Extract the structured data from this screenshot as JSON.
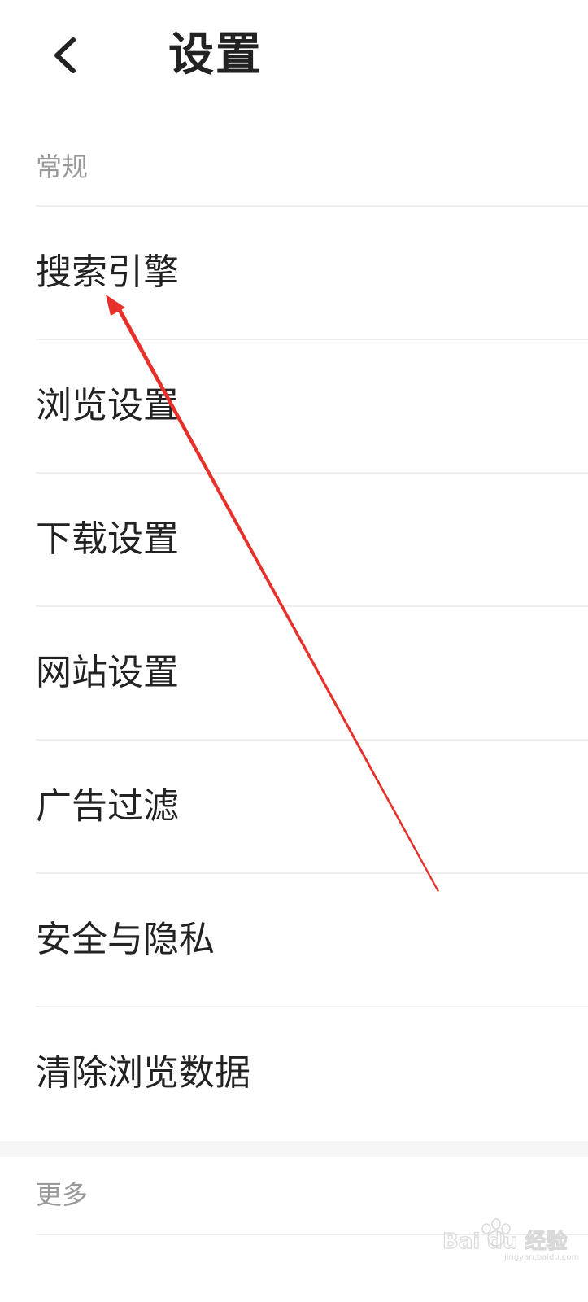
{
  "header": {
    "title": "设置",
    "back_icon": "chevron-left-icon"
  },
  "sections": {
    "general": {
      "title": "常规",
      "items": [
        {
          "label": "搜索引擎"
        },
        {
          "label": "浏览设置"
        },
        {
          "label": "下载设置"
        },
        {
          "label": "网站设置"
        },
        {
          "label": "广告过滤"
        },
        {
          "label": "安全与隐私"
        },
        {
          "label": "清除浏览数据"
        }
      ]
    },
    "more": {
      "title": "更多"
    }
  },
  "watermark": {
    "text": "Bai du 经验",
    "sub": "jingyan.baidu.com"
  },
  "colors": {
    "text": "#222222",
    "section_title": "#999999",
    "divider": "#eeeeee",
    "gap": "#f5f5f5",
    "annotation_arrow": "#e8302a"
  }
}
